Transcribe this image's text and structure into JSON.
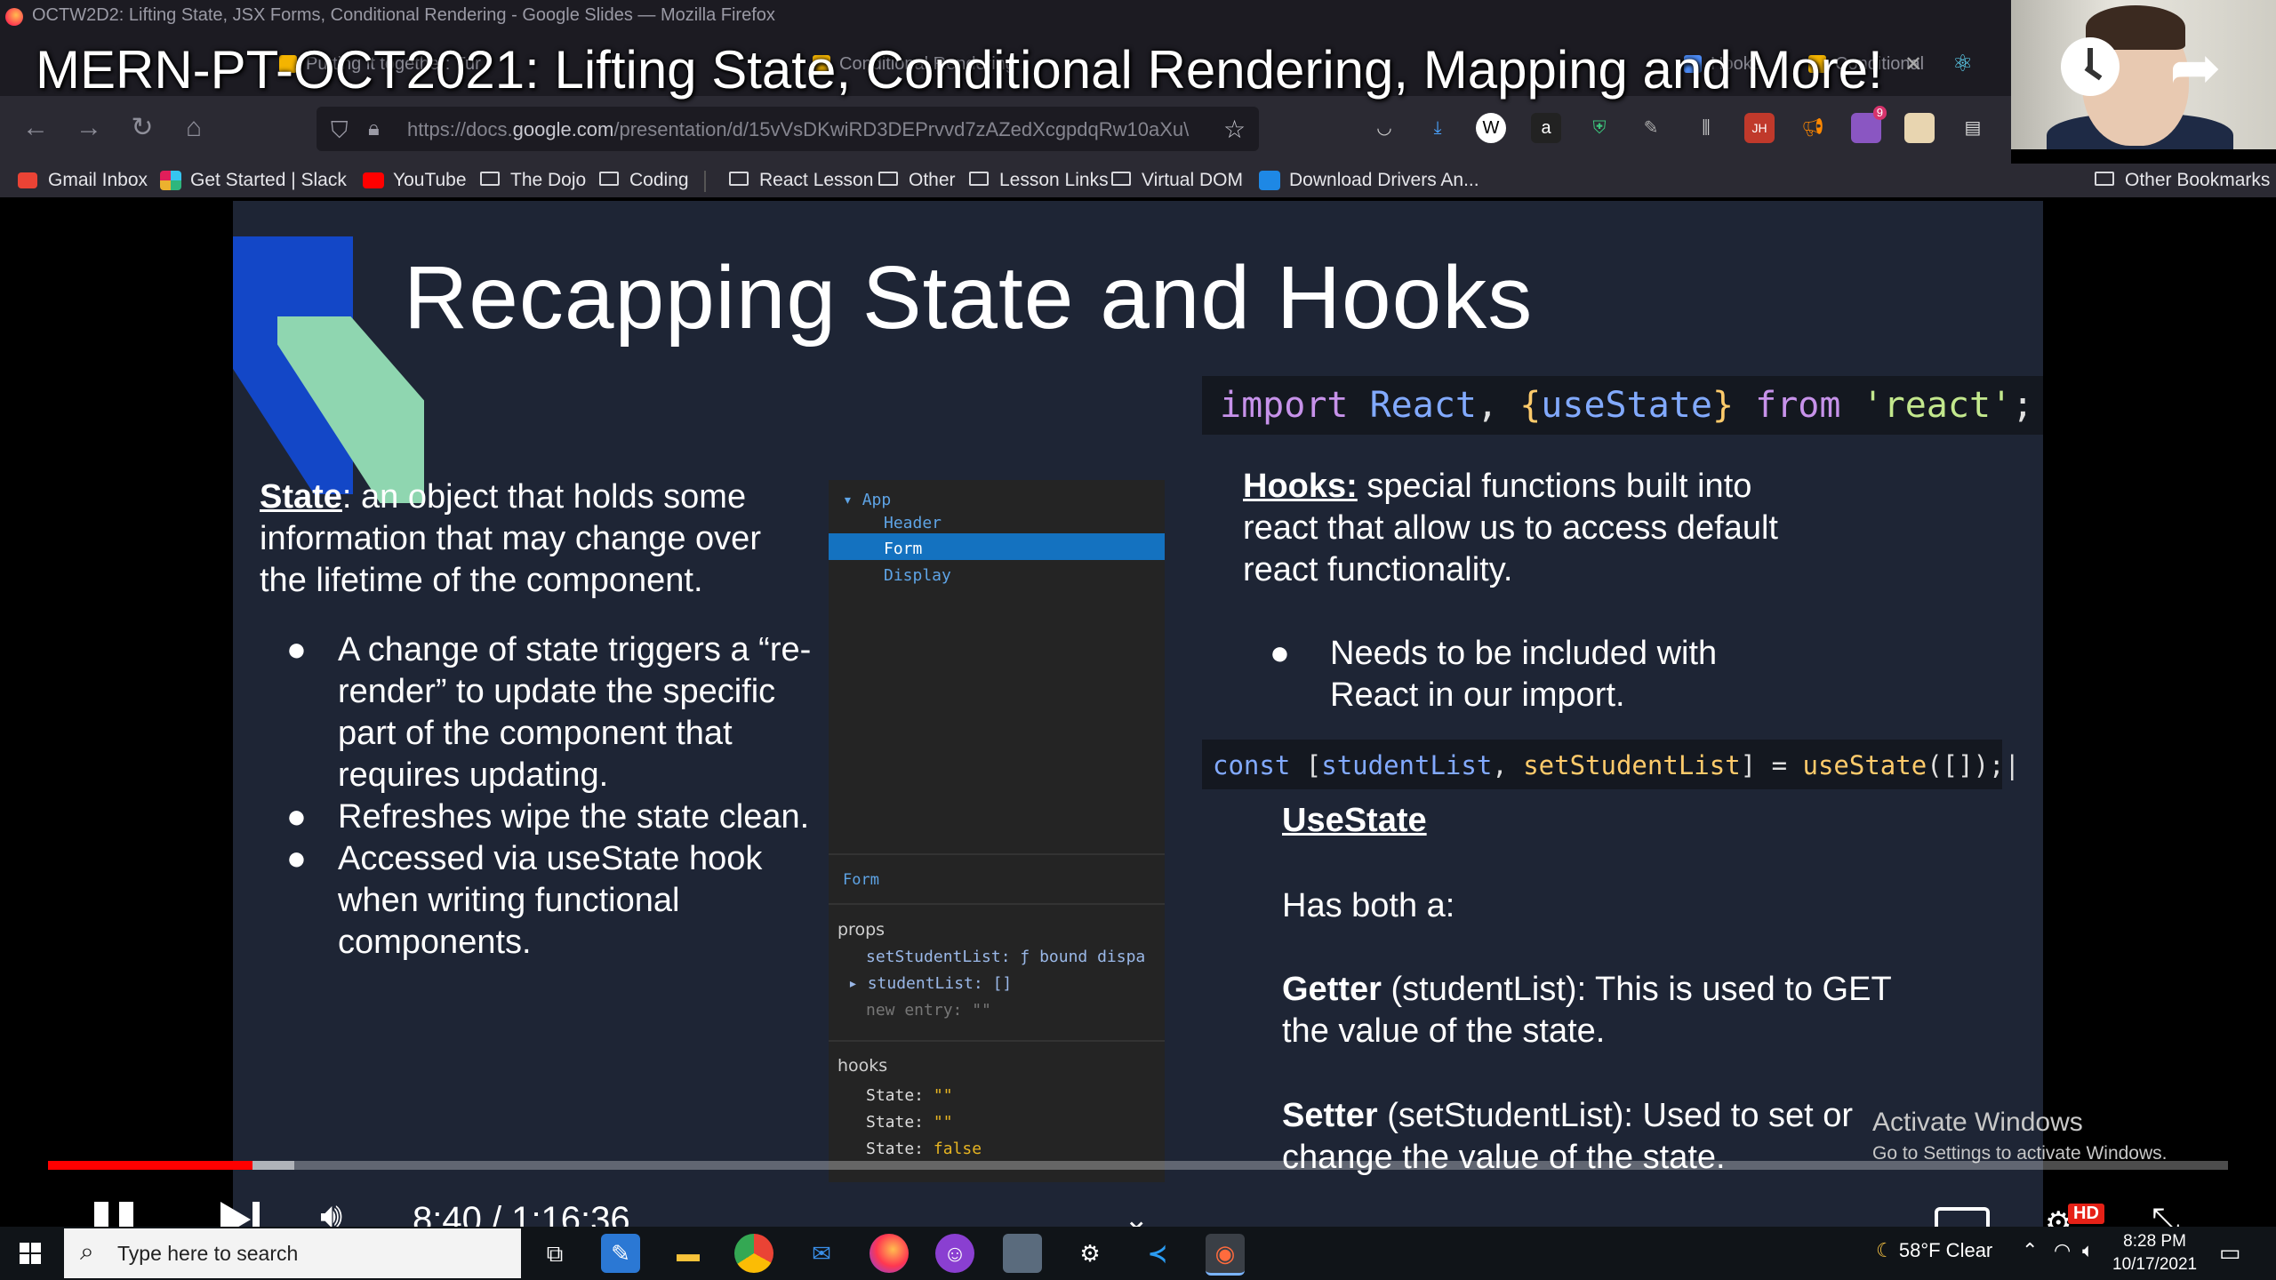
{
  "browser": {
    "window_title": "OCTW2D2: Lifting State, JSX Forms, Conditional Rendering - Google Slides — Mozilla Firefox",
    "tabs": [
      "Putting it together: Tur",
      "Conditional Rendering",
      "Hooks",
      "Conditional"
    ],
    "url_prefix": "https://docs.",
    "url_domain": "google.com",
    "url_rest": "/presentation/d/15vVsDKwiRD3DEPrvvd7zAZedXcgpdqRw10aXu\\",
    "bookmarks": [
      "Gmail Inbox",
      "Get Started | Slack",
      "YouTube",
      "The Dojo",
      "Coding",
      "React Lesson",
      "Other",
      "Lesson Links",
      "Virtual DOM",
      "Download Drivers An..."
    ],
    "other_bookmarks": "Other Bookmarks",
    "ext_badge": "9"
  },
  "video": {
    "title": "MERN-PT-OCT2021: Lifting State, Conditional Rendering, Mapping and More!",
    "time": "8:40 / 1:16:36",
    "progress": 0.094,
    "buffered": 0.113,
    "hd_badge": "HD"
  },
  "slide": {
    "title": "Recapping State and Hooks",
    "state_term": "State",
    "state_def": ": an object that holds some information that may change over the lifetime of the component.",
    "state_bullets": [
      "A change of state triggers a “re-render” to update the specific part of the component that requires updating.",
      "Refreshes wipe the state clean.",
      "Accessed via useState hook when writing functional components."
    ],
    "devtools": {
      "tree_root": "App",
      "tree_children": [
        "Header",
        "Form",
        "Display"
      ],
      "selected": "Form",
      "props_label": "props",
      "props": [
        "setStudentList: ƒ bound dispa",
        "studentList: []",
        "new entry: \"\""
      ],
      "hooks_label": "hooks",
      "hooks": [
        {
          "k": "State:",
          "v": "\"\""
        },
        {
          "k": "State:",
          "v": "\"\""
        },
        {
          "k": "State:",
          "v": "false"
        }
      ]
    },
    "code_import": {
      "kw1": "import",
      "cls": "React",
      "p1": ", ",
      "b1": "{",
      "fn": "useState",
      "b2": "}",
      "kw2": " from ",
      "str": "'react'",
      "end": ";"
    },
    "hooks_term": "Hooks:",
    "hooks_def": " special functions built into react that allow us to access default react functionality.",
    "hooks_bullet": "Needs to be included with React in our import.",
    "code_const": {
      "kw": "const ",
      "p1": "[",
      "v1": "studentList",
      "p2": ", ",
      "v2": "setStudentList",
      "p3": "] = ",
      "fn": "useState",
      "p4": "([]);"
    },
    "usestate_heading": "UseState",
    "has_both": "Has both a:",
    "getter_term": "Getter",
    "getter_text": " (studentList): This is used to GET the value of the state.",
    "setter_term": "Setter",
    "setter_text": " (setStudentList): Used to set or change the value of the state."
  },
  "windows": {
    "activate_line1": "Activate Windows",
    "activate_line2": "Go to Settings to activate Windows.",
    "search_placeholder": "Type here to search",
    "weather": "58°F  Clear",
    "time": "8:28 PM",
    "date": "10/17/2021"
  },
  "colors": {
    "accent_red": "#ff0000",
    "slide_bg": "#1e2535",
    "selection_blue": "#1472c0"
  }
}
